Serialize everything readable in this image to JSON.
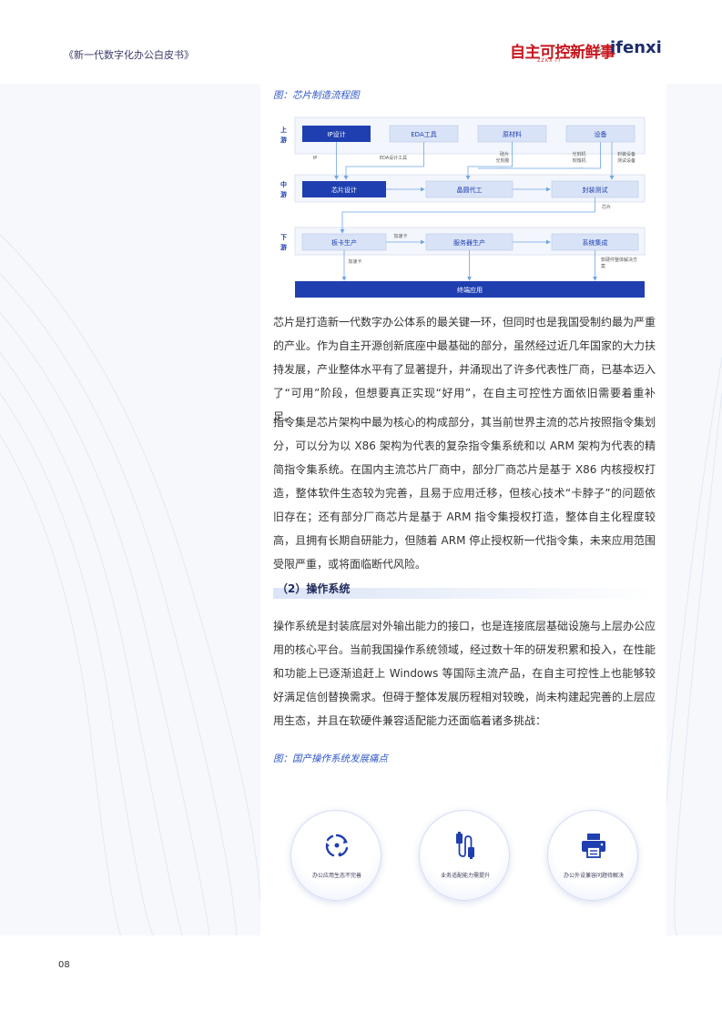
{
  "header": {
    "title": "《新一代数字化办公白皮书》",
    "logo_main": "自主可控新鲜事",
    "logo_sub": "ZZKX·IT",
    "logo_sep": "×",
    "logo_partner": "ifenxi"
  },
  "figure1": {
    "caption": "图：芯片制造流程图",
    "rows": {
      "up": "上游",
      "mid": "中游",
      "down": "下游"
    },
    "up_boxes": [
      "IP设计",
      "EDA工具",
      "原材料",
      "设备"
    ],
    "mid_boxes": [
      "芯片设计",
      "晶圆代工",
      "封装测试"
    ],
    "down_boxes": [
      "板卡生产",
      "服务器生产",
      "系统集成"
    ],
    "bottom_box": "终端应用",
    "labels": {
      "ip": "IP",
      "eda": "EDA设计工具",
      "wafer": "硅片",
      "photoresist": "光刻胶",
      "dots1": "……",
      "litho": "光刻机",
      "etch": "刻蚀机",
      "dots2": "……",
      "pack": "封装设备",
      "test": "测试设备",
      "chip": "芯片",
      "accel1": "加速卡",
      "accel2": "加速卡",
      "solution1": "软硬件整体解决方",
      "solution2": "案"
    }
  },
  "paragraphs": {
    "p1": "芯片是打造新一代数字办公体系的最关键一环，但同时也是我国受制约最为严重的产业。作为自主开源创新底座中最基础的部分，虽然经过近几年国家的大力扶持发展，产业整体水平有了显著提升，并涌现出了许多代表性厂商，已基本迈入了“可用”阶段，但想要真正实现“好用”，在自主可控性方面依旧需要着重补足。",
    "p2": "指令集是芯片架构中最为核心的构成部分，其当前世界主流的芯片按照指令集划分，可以分为以 X86 架构为代表的复杂指令集系统和以 ARM 架构为代表的精简指令集系统。在国内主流芯片厂商中，部分厂商芯片是基于 X86 内核授权打造，整体软件生态较为完善，且易于应用迁移，但核心技术“卡脖子”的问题依旧存在；还有部分厂商芯片是基于 ARM 指令集授权打造，整体自主化程度较高，且拥有长期自研能力，但随着 ARM 停止授权新一代指令集，未来应用范围受限严重，或将面临断代风险。",
    "p3": "操作系统是封装底层对外输出能力的接口，也是连接底层基础设施与上层办公应用的核心平台。当前我国操作系统领域，经过数十年的研发积累和投入，在性能和功能上已逐渐追赶上 Windows 等国际主流产品，在自主可控性上也能够较好满足信创替换需求。但碍于整体发展历程相对较晚，尚未构建起完善的上层应用生态，并且在软硬件兼容适配能力还面临着诸多挑战："
  },
  "section": {
    "heading": "（2）操作系统"
  },
  "figure2": {
    "caption": "图：国产操作系统发展痛点",
    "items": [
      {
        "label": "办公应用生态不完善",
        "icon": "refresh-cycle-icon"
      },
      {
        "label": "业务适配能力需提升",
        "icon": "usb-cable-icon"
      },
      {
        "label": "办公外设兼容问题待解决",
        "icon": "printer-icon"
      }
    ]
  },
  "footer": {
    "page": "08"
  },
  "colors": {
    "primary": "#1f3fb0",
    "light_box": "#d9e3f7",
    "accent_red": "#c8161d",
    "caption_blue": "#2f56c6"
  }
}
